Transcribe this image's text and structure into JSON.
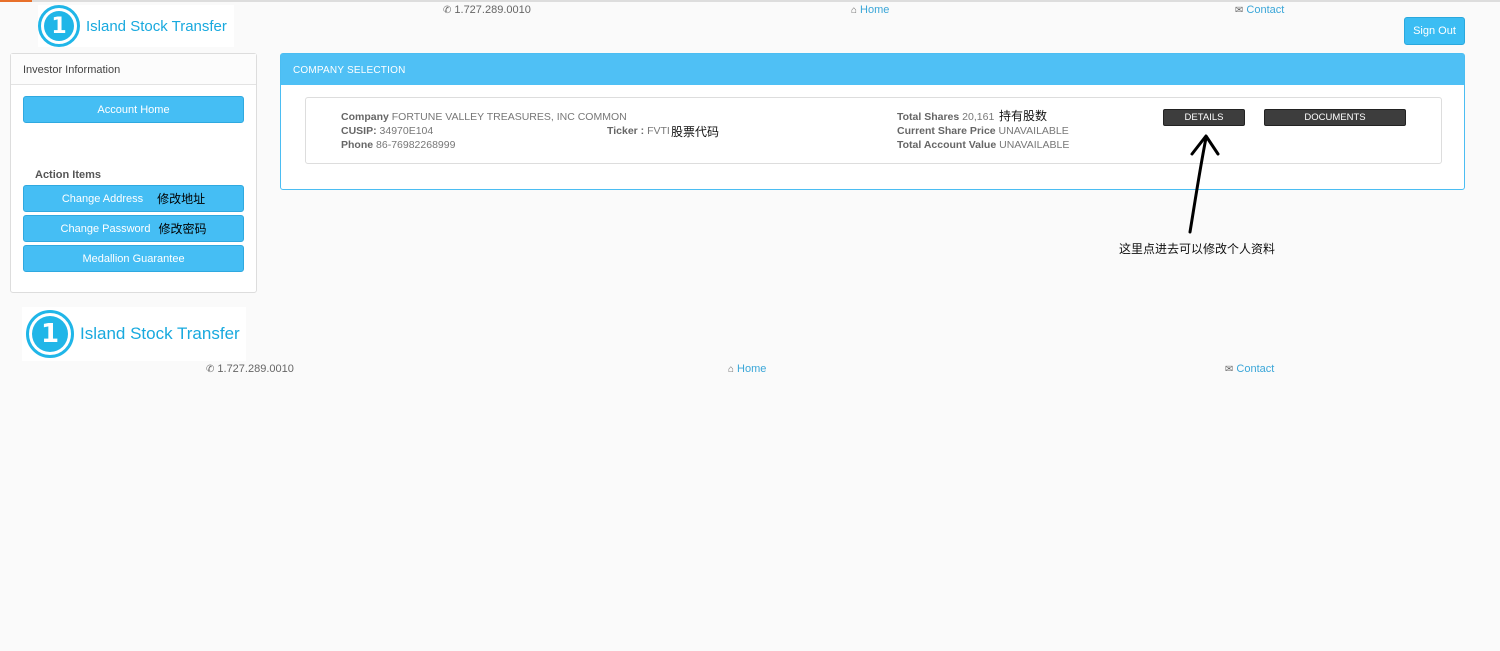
{
  "header": {
    "logo_text": "Island Stock Transfer",
    "phone": "1.727.289.0010",
    "home_label": "Home",
    "contact_label": "Contact",
    "signout_label": "Sign Out"
  },
  "sidebar": {
    "title": "Investor Information",
    "account_home_label": "Account Home",
    "action_items_title": "Action Items",
    "items": [
      {
        "label": "Change Address",
        "note": "修改地址"
      },
      {
        "label": "Change Password",
        "note": "修改密码"
      },
      {
        "label": "Medallion Guarantee",
        "note": ""
      }
    ]
  },
  "panel": {
    "title": "COMPANY SELECTION",
    "company_label": "Company",
    "company_value": "FORTUNE VALLEY TREASURES, INC COMMON",
    "cusip_label": "CUSIP:",
    "cusip_value": "34970E104",
    "phone_label": "Phone",
    "phone_value": "86-76982268999",
    "ticker_label": "Ticker :",
    "ticker_value": "FVTI",
    "ticker_note": "股票代码",
    "total_shares_label": "Total Shares",
    "total_shares_value": "20,161",
    "total_shares_note": "持有股数",
    "price_label": "Current Share Price",
    "price_value": "UNAVAILABLE",
    "account_value_label": "Total Account Value",
    "account_value_value": "UNAVAILABLE",
    "details_label": "DETAILS",
    "documents_label": "DOCUMENTS"
  },
  "annotation": {
    "arrow_note": "这里点进去可以修改个人资料"
  },
  "footer": {
    "logo_text": "Island Stock Transfer",
    "phone": "1.727.289.0010",
    "home_label": "Home",
    "contact_label": "Contact"
  },
  "colors": {
    "accent": "#4fc0f5",
    "button_dark": "#3d3d3d",
    "logo_blue": "#20b6e8"
  }
}
